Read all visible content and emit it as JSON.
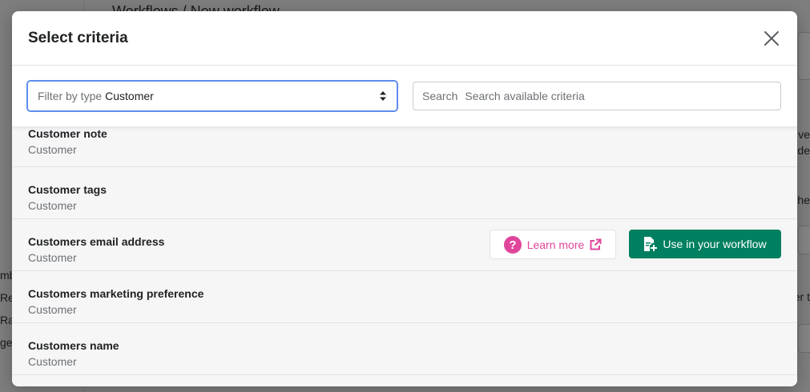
{
  "background": {
    "breadcrumb": "Workflows / New workflow",
    "left_fragments": [
      "mb",
      "Re",
      "Ra",
      "ge"
    ],
    "right_fragments": [
      "ve",
      "ide",
      "he",
      "er t"
    ]
  },
  "modal": {
    "title": "Select criteria",
    "close_icon": "close-icon"
  },
  "filter": {
    "type_label": "Filter by type",
    "type_value": "Customer"
  },
  "search": {
    "label": "Search",
    "placeholder": "Search available criteria",
    "value": ""
  },
  "criteria": [
    {
      "name": "Customer note",
      "type": "Customer"
    },
    {
      "name": "Customer tags",
      "type": "Customer"
    },
    {
      "name": "Customers email address",
      "type": "Customer"
    },
    {
      "name": "Customers marketing preference",
      "type": "Customer"
    },
    {
      "name": "Customers name",
      "type": "Customer"
    }
  ],
  "actions": {
    "learn_more": "Learn more",
    "use_in_workflow": "Use in your workflow"
  },
  "colors": {
    "primary": "#008060",
    "learn_more": "#e0459b",
    "focus": "#5b8def"
  }
}
